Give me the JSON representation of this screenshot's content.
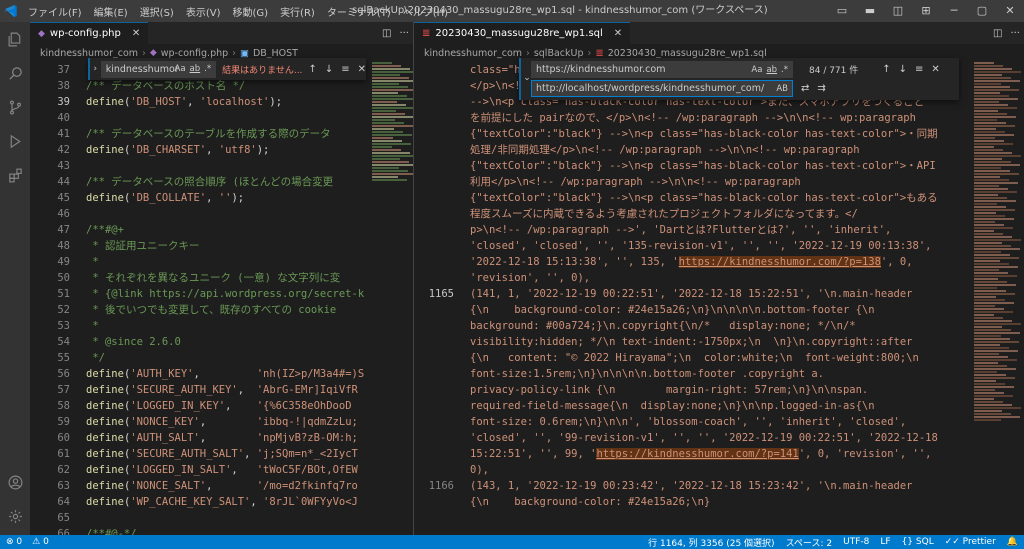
{
  "app": {
    "title": "sqlBackUp\\20230430_massugu28re_wp1.sql - kindnesshumor_com (ワークスペース)",
    "menu": [
      "ファイル(F)",
      "編集(E)",
      "選択(S)",
      "表示(V)",
      "移動(G)",
      "実行(R)",
      "ターミナル(T)",
      "ヘルプ(H)"
    ]
  },
  "activity": [
    "explorer-icon",
    "search-icon",
    "source-control-icon",
    "run-debug-icon",
    "extensions-icon",
    "account-icon",
    "manage-gear-icon"
  ],
  "left": {
    "tab": "wp-config.php",
    "breadcrumb": [
      "kindnesshumor_com",
      "wp-config.php",
      "DB_HOST"
    ],
    "find": {
      "query": "kindnesshumor",
      "opts": [
        "Aa",
        "ab",
        ".*"
      ],
      "result": "結果はありません..."
    },
    "lines": [
      {
        "n": "37",
        "t": ""
      },
      {
        "n": "38",
        "t": "/** データベースのホスト名 */"
      },
      {
        "n": "39",
        "t": "define('DB_HOST', 'localhost');"
      },
      {
        "n": "40",
        "t": ""
      },
      {
        "n": "41",
        "t": "/** データベースのテーブルを作成する際のデータ"
      },
      {
        "n": "42",
        "t": "define('DB_CHARSET', 'utf8');"
      },
      {
        "n": "43",
        "t": ""
      },
      {
        "n": "44",
        "t": "/** データベースの照合順序 (ほとんどの場合変更"
      },
      {
        "n": "45",
        "t": "define('DB_COLLATE', '');"
      },
      {
        "n": "46",
        "t": ""
      },
      {
        "n": "47",
        "t": "/**#@+"
      },
      {
        "n": "48",
        "t": " * 認証用ユニークキー"
      },
      {
        "n": "49",
        "t": " *"
      },
      {
        "n": "50",
        "t": " * それぞれを異なるユニーク (一意) な文字列に変"
      },
      {
        "n": "51",
        "t": " * {@link https://api.wordpress.org/secret-k"
      },
      {
        "n": "52",
        "t": " * 後でいつでも変更して、既存のすべての cookie"
      },
      {
        "n": "53",
        "t": " *"
      },
      {
        "n": "54",
        "t": " * @since 2.6.0"
      },
      {
        "n": "55",
        "t": " */"
      },
      {
        "n": "56",
        "t": "define('AUTH_KEY',         'nh(IZ>p/M3a4#=)S"
      },
      {
        "n": "57",
        "t": "define('SECURE_AUTH_KEY',  'AbrG-EMr]IqiVfR"
      },
      {
        "n": "58",
        "t": "define('LOGGED_IN_KEY',    '{%6C358eOhDooD"
      },
      {
        "n": "59",
        "t": "define('NONCE_KEY',        'ibbq-!|qdmZzLu;"
      },
      {
        "n": "60",
        "t": "define('AUTH_SALT',        'npMjvB?zB-OM:h;"
      },
      {
        "n": "61",
        "t": "define('SECURE_AUTH_SALT', 'j;SQm=n*_<2IycT"
      },
      {
        "n": "62",
        "t": "define('LOGGED_IN_SALT',   'tWoC5F/BOt,OfEW"
      },
      {
        "n": "63",
        "t": "define('NONCE_SALT',       '/mo=d2fkinfq7ro"
      },
      {
        "n": "64",
        "t": "define('WP_CACHE_KEY_SALT', '8rJL`0WFYyVo<J"
      },
      {
        "n": "65",
        "t": ""
      },
      {
        "n": "66",
        "t": "/**#@-*/"
      }
    ]
  },
  "right": {
    "tab": "20230430_massugu28re_wp1.sql",
    "breadcrumb": [
      "kindnesshumor_com",
      "sqlBackUp",
      "20230430_massugu28re_wp1.sql"
    ],
    "find": {
      "query": "https://kindnesshumor.com",
      "replace": "http://localhost/wordpress/kindnesshumor_com/",
      "opts": [
        "Aa",
        "ab",
        ".*"
      ],
      "replace_opt": "AB",
      "count": "84 / 771 件"
    },
    "lines": [
      {
        "n": "",
        "t": "class=\"has-black-color has-text-color\">などにコンパイル&amp;buildされます。"
      },
      {
        "n": "",
        "t": "</p>\\n<!-- /wp:paragraph -->\\n\\n<!-- wp:paragraph {\"textColor\":\"black\"}"
      },
      {
        "n": "",
        "t": "-->\\n<p class=\"has-black-color has-text-color\">また、スマホアプリをつくること"
      },
      {
        "n": "",
        "t": "を前提にした pairなので、</p>\\n<!-- /wp:paragraph -->\\n\\n<!-- wp:paragraph"
      },
      {
        "n": "",
        "t": "{\"textColor\":\"black\"} -->\\n<p class=\"has-black-color has-text-color\">・同期"
      },
      {
        "n": "",
        "t": "処理/非同期処理</p>\\n<!-- /wp:paragraph -->\\n\\n<!-- wp:paragraph"
      },
      {
        "n": "",
        "t": "{\"textColor\":\"black\"} -->\\n<p class=\"has-black-color has-text-color\">・API"
      },
      {
        "n": "",
        "t": "利用</p>\\n<!-- /wp:paragraph -->\\n\\n<!-- wp:paragraph"
      },
      {
        "n": "",
        "t": "{\"textColor\":\"black\"} -->\\n<p class=\"has-black-color has-text-color\">もある"
      },
      {
        "n": "",
        "t": "程度スムーズに内蔵できるよう考慮されたプロジェクトフォルダになってます。</"
      },
      {
        "n": "",
        "t": "p>\\n<!-- /wp:paragraph -->', 'Dartとは?Flutterとは?', '', 'inherit',"
      },
      {
        "n": "",
        "t": "'closed', 'closed', '', '135-revision-v1', '', '', '2022-12-19 00:13:38',"
      },
      {
        "n": "",
        "t": "'2022-12-18 15:13:38', '', 135, 'https://kindnesshumor.com/?p=138', 0,"
      },
      {
        "n": "",
        "t": "'revision', '', 0),"
      },
      {
        "n": "1165",
        "t": "(141, 1, '2022-12-19 00:22:51', '2022-12-18 15:22:51', '\\n.main-header"
      },
      {
        "n": "",
        "t": "{\\n    background-color: #24e15a26;\\n}\\n\\n\\n\\n.bottom-footer {\\n"
      },
      {
        "n": "",
        "t": "background: #00a724;}\\n.copyright{\\n/*   display:none; */\\n/*"
      },
      {
        "n": "",
        "t": "visibility:hidden; */\\n text-indent:-1750px;\\n  \\n}\\n.copyright::after"
      },
      {
        "n": "",
        "t": "{\\n   content: \"© 2022 Hirayama\";\\n  color:white;\\n  font-weight:800;\\n"
      },
      {
        "n": "",
        "t": "font-size:1.5rem;\\n}\\n\\n\\n\\n.bottom-footer .copyright a."
      },
      {
        "n": "",
        "t": "privacy-policy-link {\\n        margin-right: 57rem;\\n}\\n\\nspan."
      },
      {
        "n": "",
        "t": "required-field-message{\\n  display:none;\\n}\\n\\np.logged-in-as{\\n"
      },
      {
        "n": "",
        "t": "font-size: 0.6rem;\\n}\\n\\n', 'blossom-coach', '', 'inherit', 'closed',"
      },
      {
        "n": "",
        "t": "'closed', '', '99-revision-v1', '', '', '2022-12-19 00:22:51', '2022-12-18"
      },
      {
        "n": "",
        "t": "15:22:51', '', 99, 'https://kindnesshumor.com/?p=141', 0, 'revision', '',"
      },
      {
        "n": "",
        "t": "0),"
      },
      {
        "n": "1166",
        "t": "(143, 1, '2022-12-19 00:23:42', '2022-12-18 15:23:42', '\\n.main-header"
      },
      {
        "n": "",
        "t": "{\\n    background-color: #24e15a26;\\n}"
      }
    ]
  },
  "status": {
    "left": [
      "⊗ 0",
      "⚠ 0"
    ],
    "right": [
      "行 1164, 列 3356 (25 個選択)",
      "スペース: 2",
      "UTF-8",
      "LF",
      "SQL",
      "Prettier"
    ]
  }
}
